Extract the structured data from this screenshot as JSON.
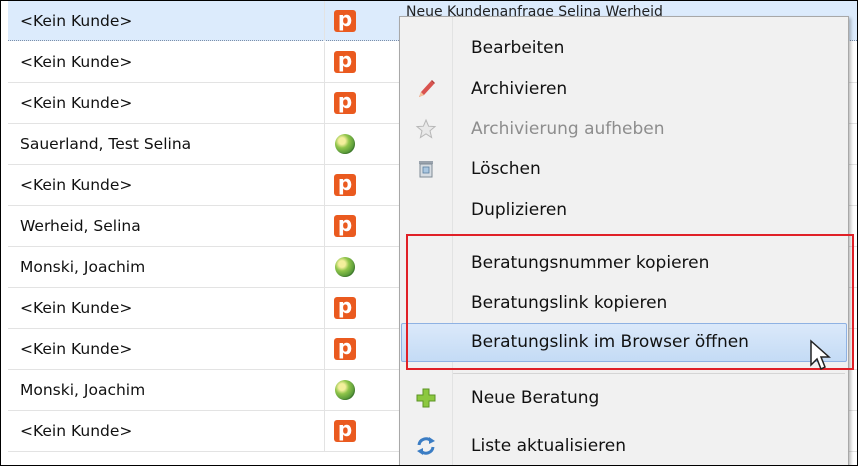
{
  "rows": [
    {
      "name": "<Kein Kunde>",
      "icon": "p-icon",
      "rest": "Neue Kundenanfrage                    Selina Werheid"
    },
    {
      "name": "<Kein Kunde>",
      "icon": "p-icon"
    },
    {
      "name": "<Kein Kunde>",
      "icon": "p-icon"
    },
    {
      "name": "Sauerland, Test Selina",
      "icon": "globe-icon"
    },
    {
      "name": "<Kein Kunde>",
      "icon": "p-icon"
    },
    {
      "name": "Werheid, Selina",
      "icon": "p-icon"
    },
    {
      "name": "Monski, Joachim",
      "icon": "globe-icon"
    },
    {
      "name": "<Kein Kunde>",
      "icon": "p-icon"
    },
    {
      "name": "<Kein Kunde>",
      "icon": "p-icon"
    },
    {
      "name": "Monski, Joachim",
      "icon": "globe-icon"
    },
    {
      "name": "<Kein Kunde>",
      "icon": "p-icon"
    }
  ],
  "p_icon_letter": "p",
  "menu": {
    "items": [
      {
        "label": "Bearbeiten",
        "icon": null
      },
      {
        "label": "Archivieren",
        "icon": "pencil-icon"
      },
      {
        "label": "Archivierung aufheben",
        "icon": "star-icon",
        "disabled": true
      },
      {
        "label": "Löschen",
        "icon": "trash-icon"
      },
      {
        "label": "Duplizieren",
        "icon": null
      },
      {
        "label": "Beratungsnummer kopieren",
        "icon": null
      },
      {
        "label": "Beratungslink kopieren",
        "icon": null
      },
      {
        "label": "Beratungslink im Browser öffnen",
        "icon": null,
        "highlighted": true
      },
      {
        "label": "Neue Beratung",
        "icon": "plus-icon"
      },
      {
        "label": "Liste aktualisieren",
        "icon": "refresh-icon"
      }
    ]
  },
  "colors": {
    "selection_row": "#dcebfc",
    "menu_highlight": "#c4dbf5",
    "annotation_box": "#e02027",
    "p_icon": "#ea5a1f"
  }
}
